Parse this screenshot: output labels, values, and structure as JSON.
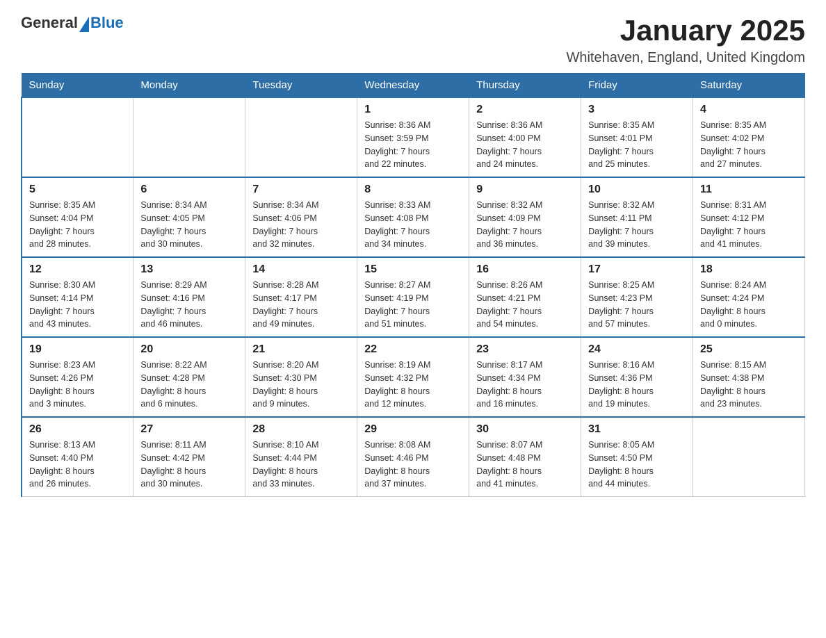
{
  "header": {
    "logo_general": "General",
    "logo_blue": "Blue",
    "month_title": "January 2025",
    "location": "Whitehaven, England, United Kingdom"
  },
  "weekdays": [
    "Sunday",
    "Monday",
    "Tuesday",
    "Wednesday",
    "Thursday",
    "Friday",
    "Saturday"
  ],
  "weeks": [
    [
      {
        "day": "",
        "info": ""
      },
      {
        "day": "",
        "info": ""
      },
      {
        "day": "",
        "info": ""
      },
      {
        "day": "1",
        "info": "Sunrise: 8:36 AM\nSunset: 3:59 PM\nDaylight: 7 hours\nand 22 minutes."
      },
      {
        "day": "2",
        "info": "Sunrise: 8:36 AM\nSunset: 4:00 PM\nDaylight: 7 hours\nand 24 minutes."
      },
      {
        "day": "3",
        "info": "Sunrise: 8:35 AM\nSunset: 4:01 PM\nDaylight: 7 hours\nand 25 minutes."
      },
      {
        "day": "4",
        "info": "Sunrise: 8:35 AM\nSunset: 4:02 PM\nDaylight: 7 hours\nand 27 minutes."
      }
    ],
    [
      {
        "day": "5",
        "info": "Sunrise: 8:35 AM\nSunset: 4:04 PM\nDaylight: 7 hours\nand 28 minutes."
      },
      {
        "day": "6",
        "info": "Sunrise: 8:34 AM\nSunset: 4:05 PM\nDaylight: 7 hours\nand 30 minutes."
      },
      {
        "day": "7",
        "info": "Sunrise: 8:34 AM\nSunset: 4:06 PM\nDaylight: 7 hours\nand 32 minutes."
      },
      {
        "day": "8",
        "info": "Sunrise: 8:33 AM\nSunset: 4:08 PM\nDaylight: 7 hours\nand 34 minutes."
      },
      {
        "day": "9",
        "info": "Sunrise: 8:32 AM\nSunset: 4:09 PM\nDaylight: 7 hours\nand 36 minutes."
      },
      {
        "day": "10",
        "info": "Sunrise: 8:32 AM\nSunset: 4:11 PM\nDaylight: 7 hours\nand 39 minutes."
      },
      {
        "day": "11",
        "info": "Sunrise: 8:31 AM\nSunset: 4:12 PM\nDaylight: 7 hours\nand 41 minutes."
      }
    ],
    [
      {
        "day": "12",
        "info": "Sunrise: 8:30 AM\nSunset: 4:14 PM\nDaylight: 7 hours\nand 43 minutes."
      },
      {
        "day": "13",
        "info": "Sunrise: 8:29 AM\nSunset: 4:16 PM\nDaylight: 7 hours\nand 46 minutes."
      },
      {
        "day": "14",
        "info": "Sunrise: 8:28 AM\nSunset: 4:17 PM\nDaylight: 7 hours\nand 49 minutes."
      },
      {
        "day": "15",
        "info": "Sunrise: 8:27 AM\nSunset: 4:19 PM\nDaylight: 7 hours\nand 51 minutes."
      },
      {
        "day": "16",
        "info": "Sunrise: 8:26 AM\nSunset: 4:21 PM\nDaylight: 7 hours\nand 54 minutes."
      },
      {
        "day": "17",
        "info": "Sunrise: 8:25 AM\nSunset: 4:23 PM\nDaylight: 7 hours\nand 57 minutes."
      },
      {
        "day": "18",
        "info": "Sunrise: 8:24 AM\nSunset: 4:24 PM\nDaylight: 8 hours\nand 0 minutes."
      }
    ],
    [
      {
        "day": "19",
        "info": "Sunrise: 8:23 AM\nSunset: 4:26 PM\nDaylight: 8 hours\nand 3 minutes."
      },
      {
        "day": "20",
        "info": "Sunrise: 8:22 AM\nSunset: 4:28 PM\nDaylight: 8 hours\nand 6 minutes."
      },
      {
        "day": "21",
        "info": "Sunrise: 8:20 AM\nSunset: 4:30 PM\nDaylight: 8 hours\nand 9 minutes."
      },
      {
        "day": "22",
        "info": "Sunrise: 8:19 AM\nSunset: 4:32 PM\nDaylight: 8 hours\nand 12 minutes."
      },
      {
        "day": "23",
        "info": "Sunrise: 8:17 AM\nSunset: 4:34 PM\nDaylight: 8 hours\nand 16 minutes."
      },
      {
        "day": "24",
        "info": "Sunrise: 8:16 AM\nSunset: 4:36 PM\nDaylight: 8 hours\nand 19 minutes."
      },
      {
        "day": "25",
        "info": "Sunrise: 8:15 AM\nSunset: 4:38 PM\nDaylight: 8 hours\nand 23 minutes."
      }
    ],
    [
      {
        "day": "26",
        "info": "Sunrise: 8:13 AM\nSunset: 4:40 PM\nDaylight: 8 hours\nand 26 minutes."
      },
      {
        "day": "27",
        "info": "Sunrise: 8:11 AM\nSunset: 4:42 PM\nDaylight: 8 hours\nand 30 minutes."
      },
      {
        "day": "28",
        "info": "Sunrise: 8:10 AM\nSunset: 4:44 PM\nDaylight: 8 hours\nand 33 minutes."
      },
      {
        "day": "29",
        "info": "Sunrise: 8:08 AM\nSunset: 4:46 PM\nDaylight: 8 hours\nand 37 minutes."
      },
      {
        "day": "30",
        "info": "Sunrise: 8:07 AM\nSunset: 4:48 PM\nDaylight: 8 hours\nand 41 minutes."
      },
      {
        "day": "31",
        "info": "Sunrise: 8:05 AM\nSunset: 4:50 PM\nDaylight: 8 hours\nand 44 minutes."
      },
      {
        "day": "",
        "info": ""
      }
    ]
  ]
}
